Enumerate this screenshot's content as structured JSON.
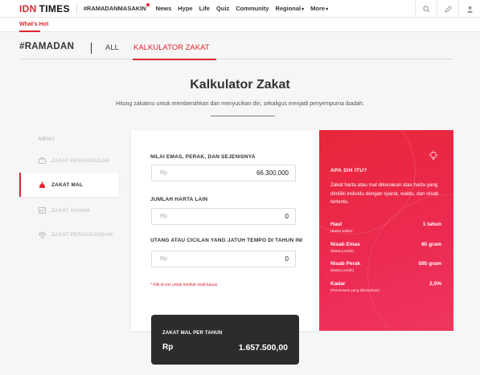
{
  "header": {
    "logo_idn": "IDN",
    "logo_times": "TIMES",
    "nav": [
      "#RAMADANMASAKIN",
      "News",
      "Hype",
      "Life",
      "Quiz",
      "Community",
      "Regional",
      "More"
    ],
    "whats_hot": "What's Hot",
    "icons": [
      "search-icon",
      "pencil-icon",
      "user-icon"
    ]
  },
  "section": {
    "title": "#RAMADAN",
    "tab_all": "ALL",
    "tab_zakat": "KALKULATOR ZAKAT"
  },
  "page": {
    "title": "Kalkulator Zakat",
    "subtitle": "Hitung zakatmu untuk membersihkan dan menyucikan diri, sekaligus menjadi penyempurna ibadah."
  },
  "menu": {
    "label": "MENU",
    "items": [
      {
        "label": "ZAKAT PENGHASILAN",
        "icon": "briefcase-icon",
        "active": false
      },
      {
        "label": "ZAKAT MAL",
        "icon": "money-bag-icon",
        "active": true
      },
      {
        "label": "ZAKAT SAHAM",
        "icon": "chart-icon",
        "active": false
      },
      {
        "label": "ZAKAT PERDAGANGAN",
        "icon": "scale-icon",
        "active": false
      }
    ]
  },
  "form": {
    "fields": [
      {
        "label": "NILAI EMAS, PERAK, DAN SEJENISNYA",
        "prefix": "Rp",
        "value": "66.300.000"
      },
      {
        "label": "JUMLAH HARTA LAIN",
        "prefix": "Rp",
        "value": "0"
      },
      {
        "label": "UTANG ATAU CICILAN YANG JATUH TEMPO DI TAHUN INI",
        "prefix": "Rp",
        "value": "0"
      }
    ],
    "footnote": "* Klik di sini untuk melihat studi kasus"
  },
  "result": {
    "label": "ZAKAT MAL PER TAHUN",
    "currency": "Rp",
    "value": "1.657.500,00"
  },
  "info": {
    "title": "APA SIH ITU?",
    "description": "Zakat harta atau mal dikenakan atas harta yang dimiliki individu dengan syarat, waktu, dan nisab tertentu.",
    "rows": [
      {
        "key": "Haul",
        "sub": "(Batas waktu)",
        "value": "1 tahun"
      },
      {
        "key": "Nisab Emas",
        "sub": "(Batas jumlah)",
        "value": "85 gram"
      },
      {
        "key": "Nisab Perak",
        "sub": "(Batas jumlah)",
        "value": "595 gram"
      },
      {
        "key": "Kadar",
        "sub": "(Persentase yang dikeluarkan)",
        "value": "2,5%"
      }
    ]
  }
}
